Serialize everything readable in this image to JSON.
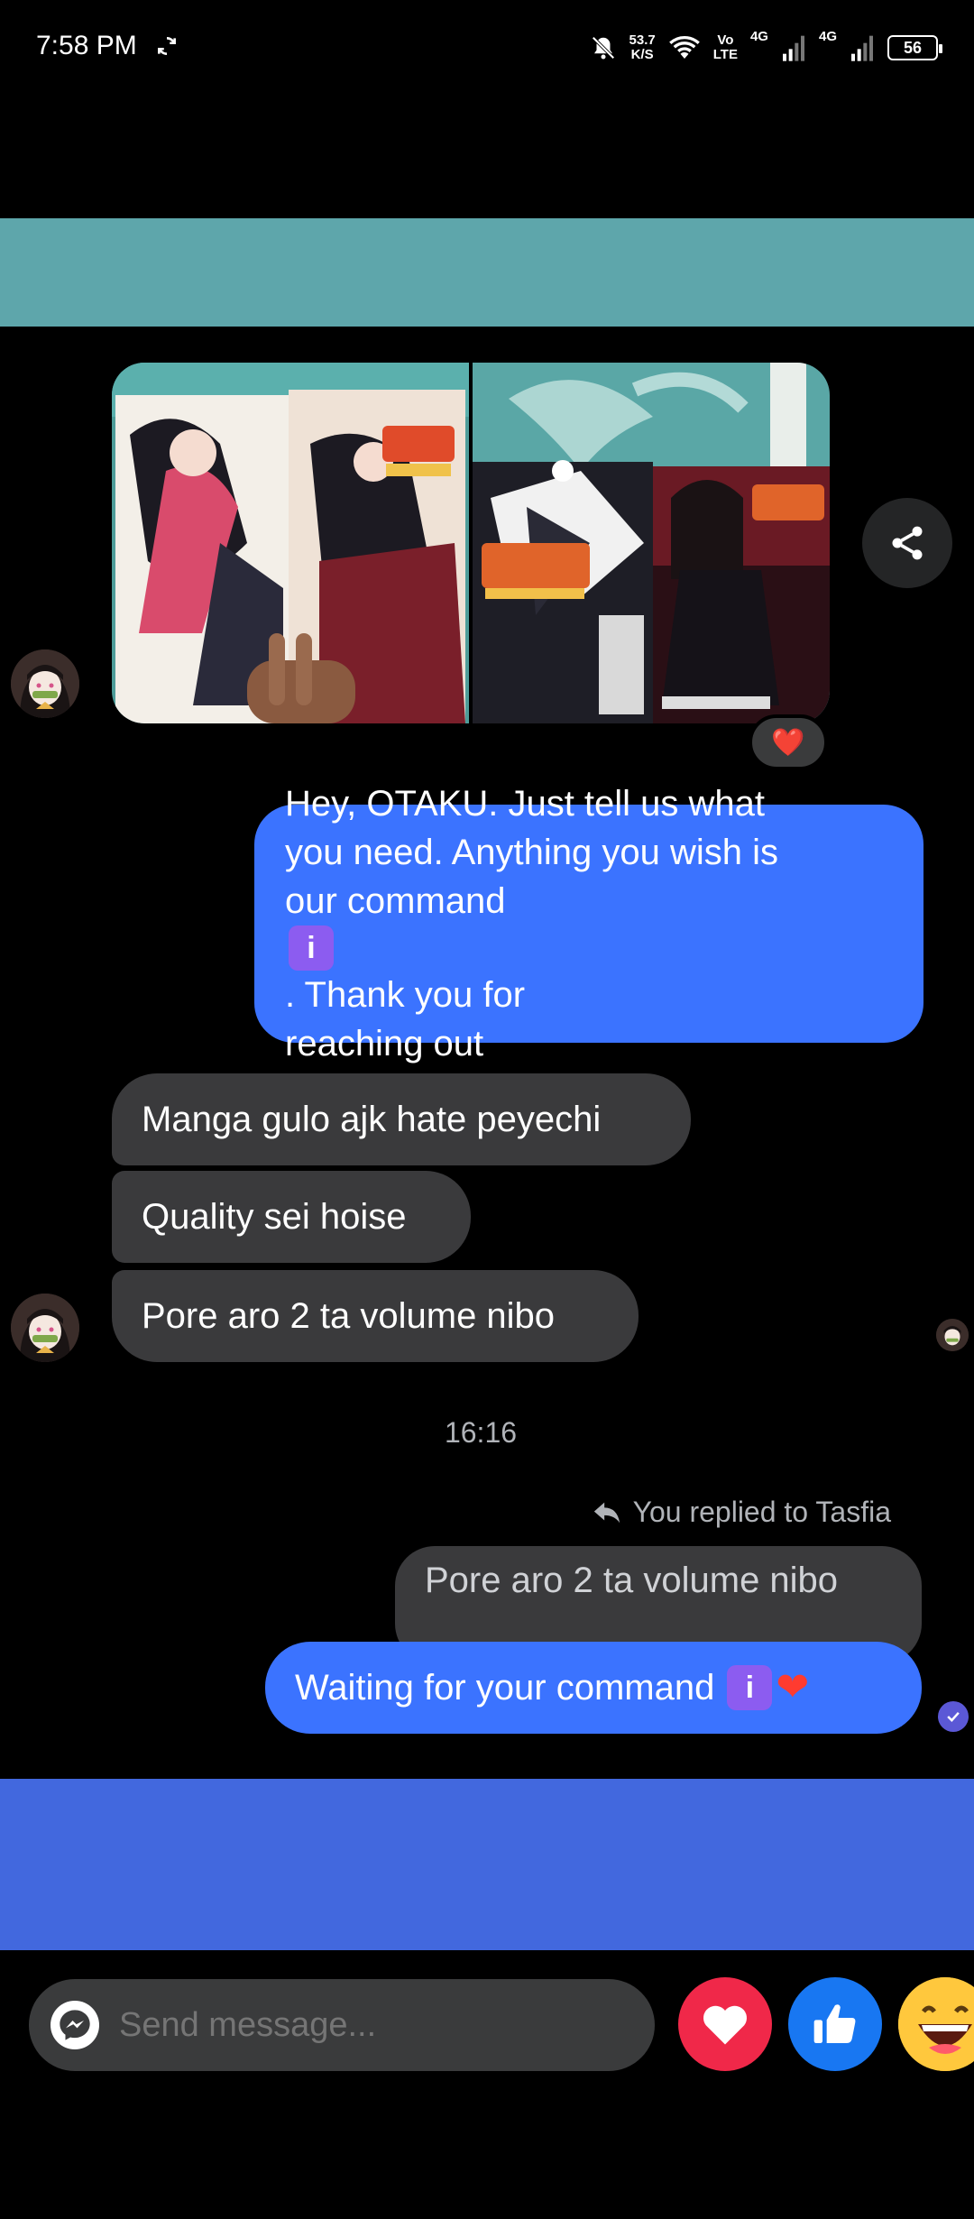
{
  "status_bar": {
    "time": "7:58 PM",
    "speed_value": "53.7",
    "speed_unit": "K/S",
    "volte_top": "Vo",
    "volte_bottom": "LTE",
    "net1": "4G",
    "net2": "4G",
    "battery": "56"
  },
  "attachment": {
    "reaction": "❤️"
  },
  "messages": {
    "outgoing_1_line1": "Hey, OTAKU. Just tell us what",
    "outgoing_1_line2": "you need. Anything you wish is",
    "outgoing_1_line3a": "our command",
    "outgoing_1_emoji": "i",
    "outgoing_1_line3b": ". Thank you for",
    "outgoing_1_line4": "reaching out",
    "incoming_1": "Manga gulo ajk hate peyechi",
    "incoming_2": "Quality sei hoise",
    "incoming_3": "Pore aro 2 ta volume nibo",
    "timestamp": "16:16",
    "replied_note": "You replied to Tasfia",
    "quoted_text": "Pore aro 2 ta volume nibo",
    "outgoing_2_text": "Waiting for your command",
    "outgoing_2_emoji": "i",
    "outgoing_2_heart": "❤"
  },
  "composer": {
    "placeholder": "Send message..."
  },
  "colors": {
    "outgoing_bubble": "#3b73ff",
    "incoming_bubble": "#3a3a3c",
    "teal_banner": "#5ea6ab",
    "blue_banner": "#4268de"
  }
}
